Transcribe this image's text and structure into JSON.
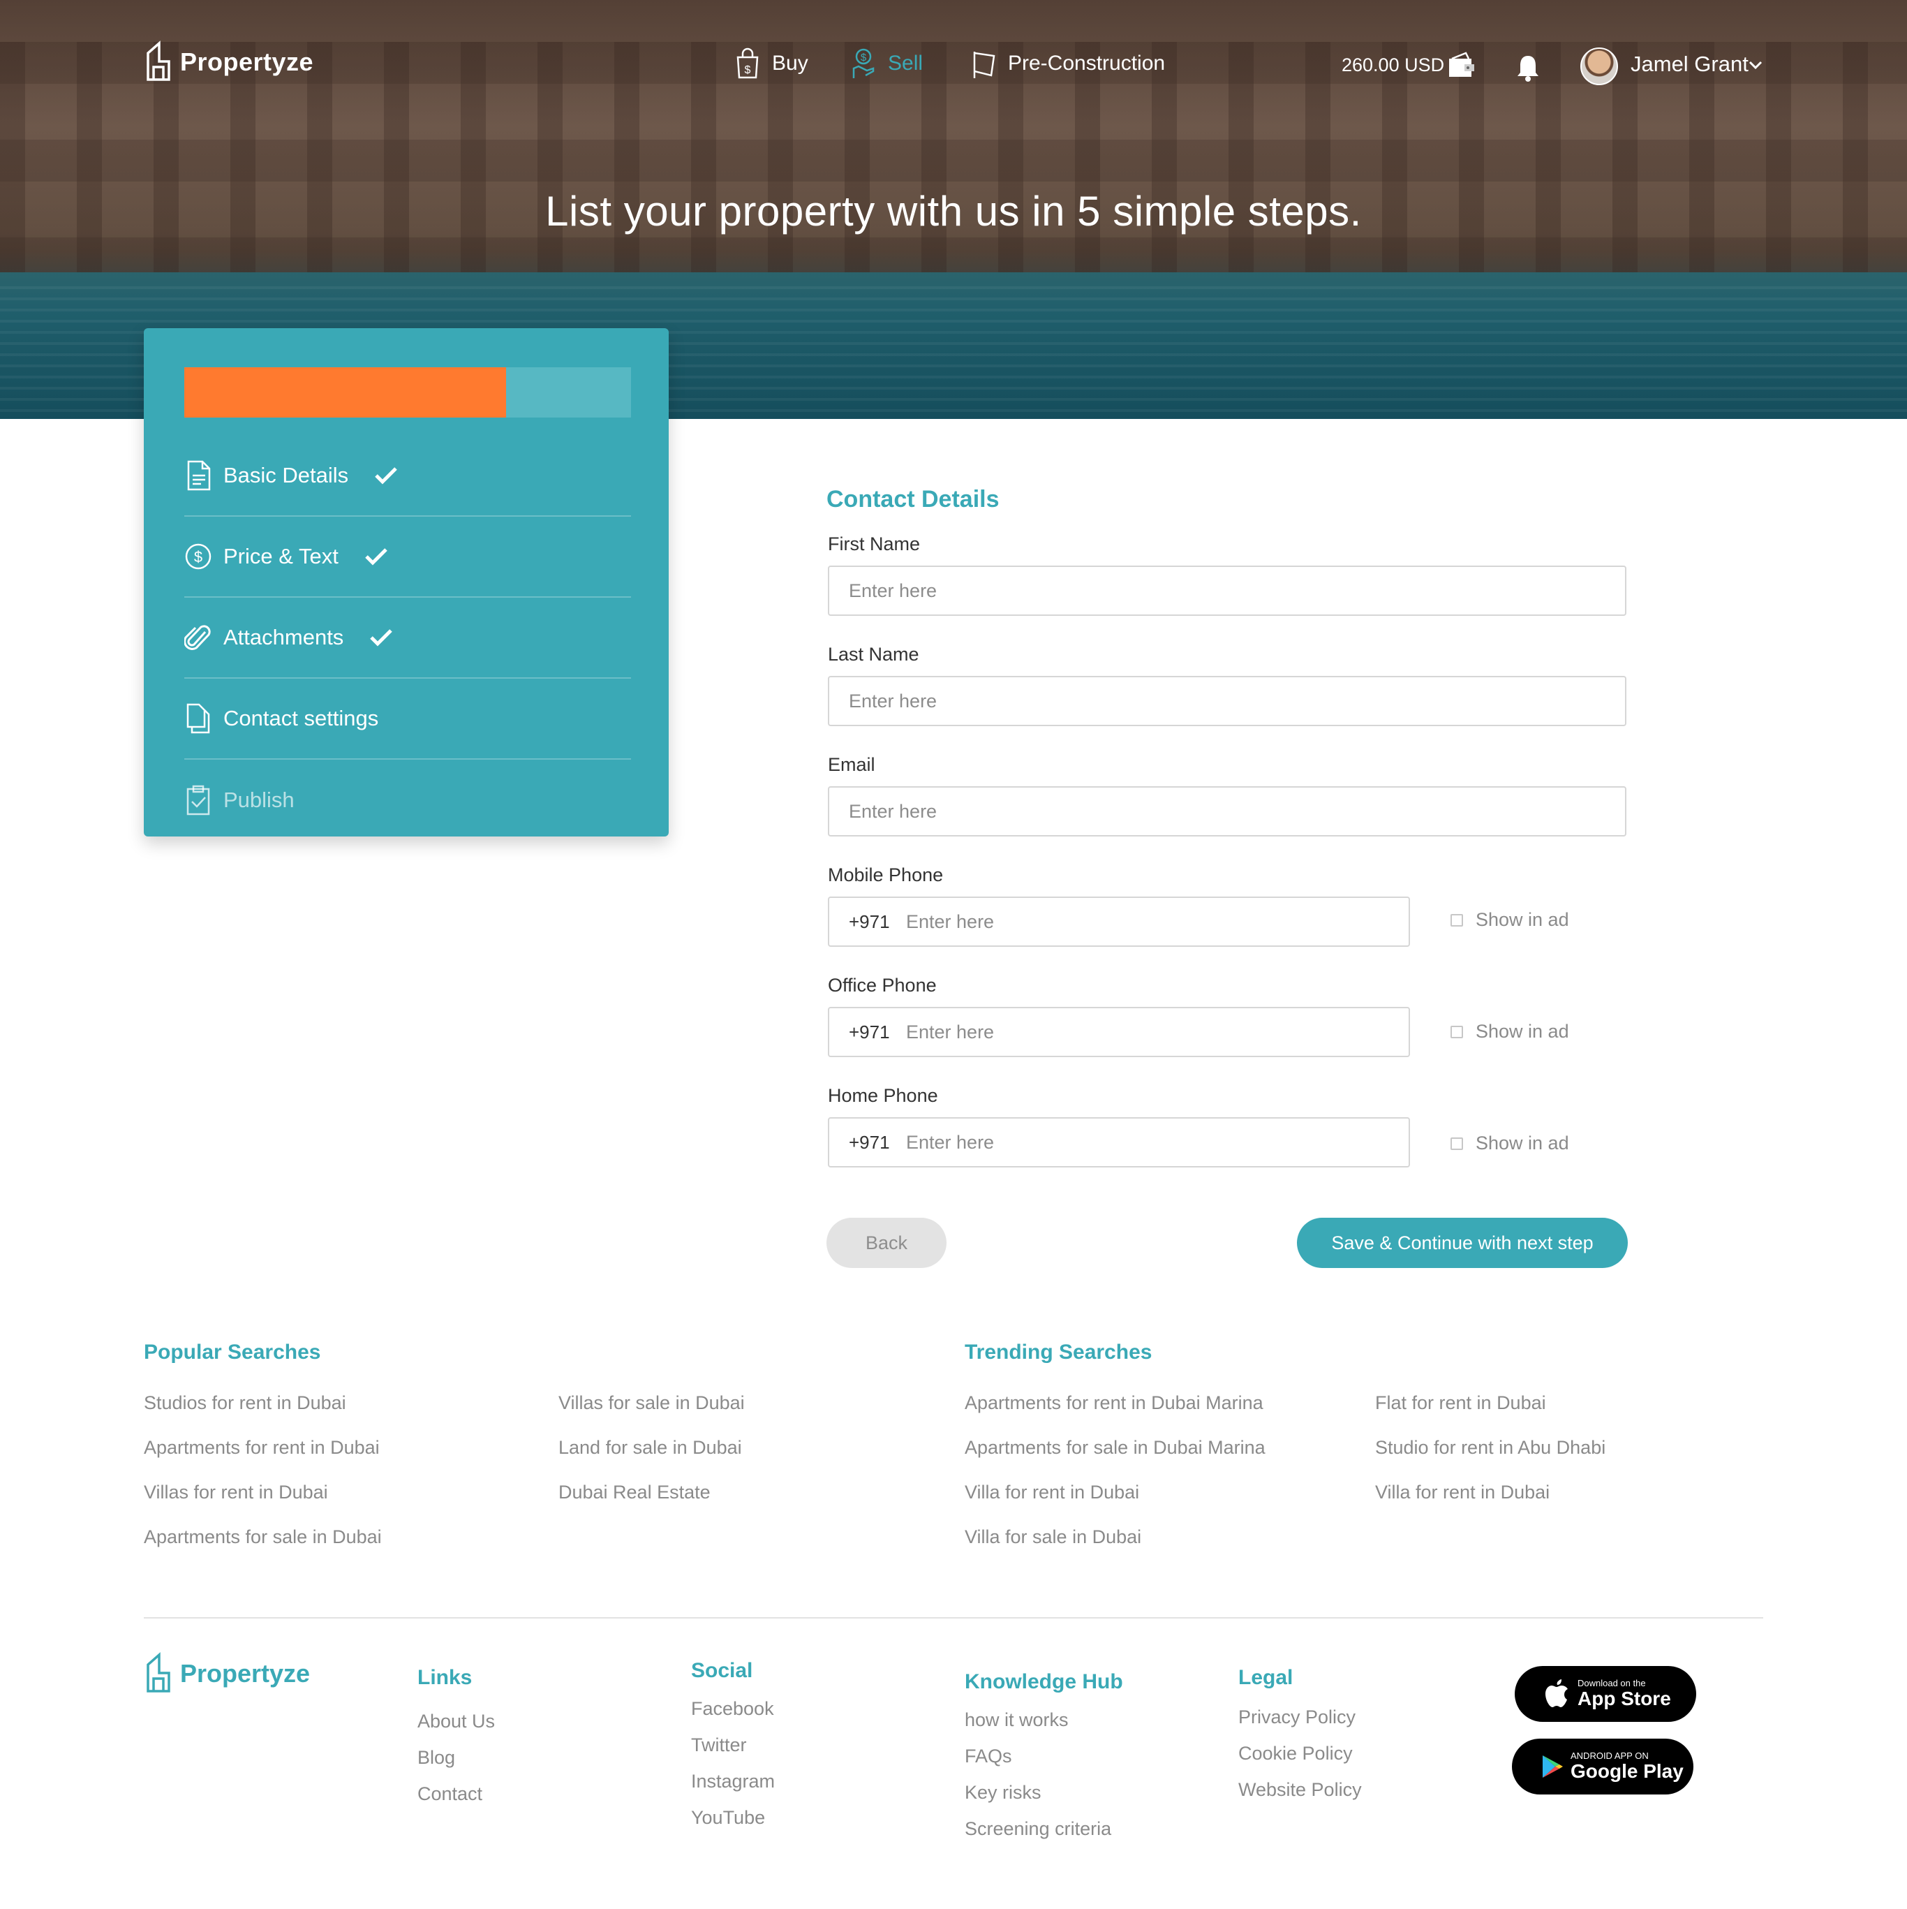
{
  "header": {
    "brand": "Propertyze",
    "nav": [
      {
        "label": "Buy",
        "icon": "shopping-bag-icon"
      },
      {
        "label": "Sell",
        "icon": "hand-money-icon",
        "active": true
      },
      {
        "label": "Pre-Construction",
        "icon": "flag-icon"
      }
    ],
    "balance": "260.00 USD",
    "user_name": "Jamel Grant"
  },
  "hero": {
    "title": "List  your property with us in 5 simple steps."
  },
  "steps": {
    "progress_fraction": 0.72,
    "items": [
      {
        "label": "Basic Details",
        "icon": "document-icon",
        "done": true
      },
      {
        "label": "Price & Text",
        "icon": "dollar-circle-icon",
        "done": true
      },
      {
        "label": "Attachments",
        "icon": "paperclip-icon",
        "done": true
      },
      {
        "label": "Contact settings",
        "icon": "files-icon",
        "done": false
      },
      {
        "label": "Publish",
        "icon": "clipboard-check-icon",
        "done": false,
        "disabled": true
      }
    ]
  },
  "form": {
    "title": "Contact Details",
    "first_name": {
      "label": "First Name",
      "placeholder": "Enter here"
    },
    "last_name": {
      "label": "Last Name",
      "placeholder": "Enter here"
    },
    "email": {
      "label": "Email",
      "placeholder": "Enter here"
    },
    "mobile": {
      "label": "Mobile Phone",
      "prefix": "+971",
      "placeholder": "Enter here",
      "show_label": "Show in ad"
    },
    "office": {
      "label": "Office Phone",
      "prefix": "+971",
      "placeholder": "Enter here",
      "show_label": "Show in ad"
    },
    "home": {
      "label": "Home Phone",
      "prefix": "+971",
      "placeholder": "Enter here",
      "show_label": "Show in ad"
    },
    "back_label": "Back",
    "next_label": "Save & Continue with next step"
  },
  "popular": {
    "title": "Popular Searches",
    "col1": [
      "Studios for rent in Dubai",
      "Apartments for rent in Dubai",
      "Villas for rent in Dubai",
      "Apartments for sale in Dubai"
    ],
    "col2": [
      "Villas for sale in Dubai",
      "Land for sale in Dubai",
      "Dubai Real Estate"
    ]
  },
  "trending": {
    "title": "Trending Searches",
    "col1": [
      "Apartments for rent in Dubai Marina",
      "Apartments for sale in Dubai Marina",
      "Villa for rent in Dubai",
      "Villa for sale in Dubai"
    ],
    "col2": [
      "Flat for rent in Dubai",
      "Studio for rent in Abu Dhabi",
      "Villa for rent in Dubai"
    ]
  },
  "footer": {
    "brand": "Propertyze",
    "links": {
      "title": "Links",
      "items": [
        "About Us",
        "Blog",
        "Contact"
      ]
    },
    "social": {
      "title": "Social",
      "items": [
        "Facebook",
        "Twitter",
        "Instagram",
        "YouTube"
      ]
    },
    "knowledge": {
      "title": "Knowledge Hub",
      "items": [
        "how it works",
        "FAQs",
        "Key risks",
        "Screening criteria"
      ]
    },
    "legal": {
      "title": "Legal",
      "items": [
        "Privacy Policy",
        "Cookie Policy",
        "Website Policy"
      ]
    },
    "app_store": {
      "small": "Download on the",
      "big": "App Store"
    },
    "google_play": {
      "small": "ANDROID APP ON",
      "big": "Google Play"
    }
  },
  "colors": {
    "accent": "#3aa9b6",
    "progress": "#ff7a2f"
  }
}
